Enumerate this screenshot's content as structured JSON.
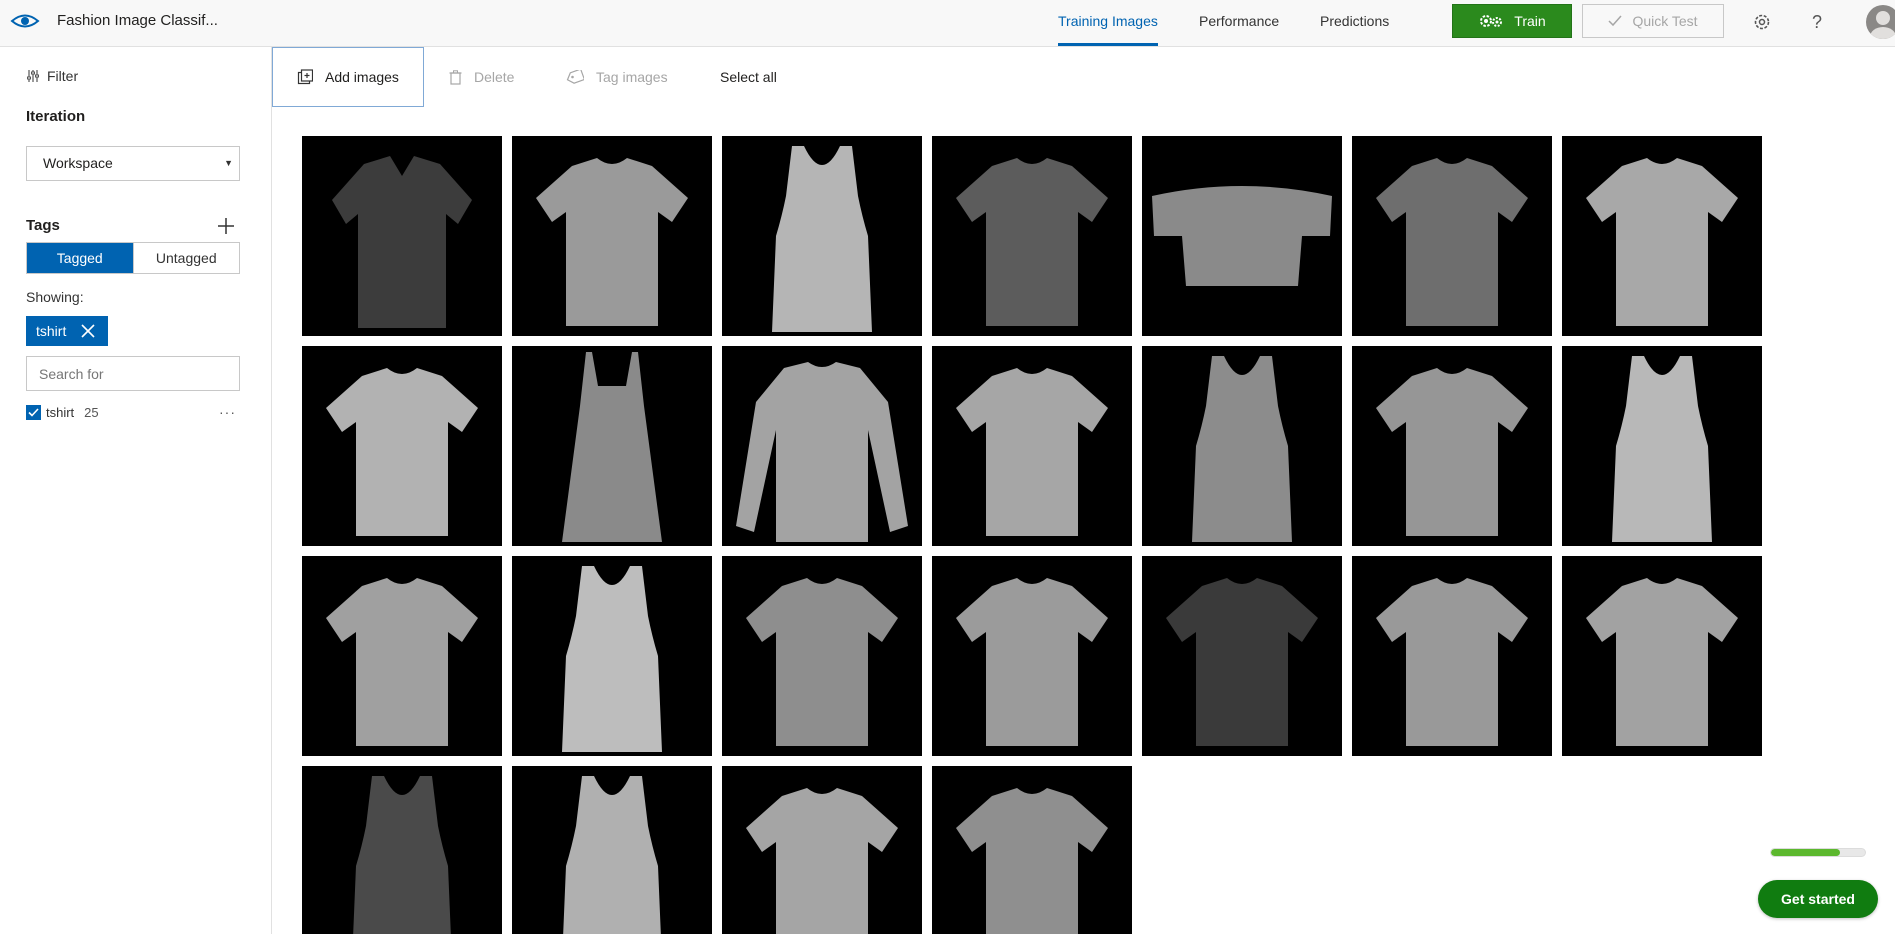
{
  "app": {
    "title": "Fashion Image Classif..."
  },
  "nav": {
    "tabs": [
      {
        "label": "Training Images",
        "active": true
      },
      {
        "label": "Performance",
        "active": false
      },
      {
        "label": "Predictions",
        "active": false
      }
    ],
    "train_label": "Train",
    "quick_test_label": "Quick Test",
    "icons": [
      "settings-gear-icon",
      "help-question-icon",
      "user-avatar"
    ]
  },
  "sidebar": {
    "filter_label": "Filter",
    "iteration_heading": "Iteration",
    "iteration_selected": "Workspace",
    "tags_heading": "Tags",
    "toggle": {
      "tagged": "Tagged",
      "untagged": "Untagged",
      "selected": "Tagged"
    },
    "showing_label": "Showing:",
    "active_filter_chip": "tshirt",
    "search_placeholder": "Search for",
    "tags": [
      {
        "name": "tshirt",
        "count": "25",
        "checked": true
      }
    ]
  },
  "toolbar": {
    "add_images": "Add images",
    "delete": "Delete",
    "tag_images": "Tag images",
    "select_all": "Select all"
  },
  "images": [
    {
      "kind": "polo",
      "shade": "#3c3c3c"
    },
    {
      "kind": "tee",
      "shade": "#9a9a9a"
    },
    {
      "kind": "tank",
      "shade": "#b5b5b5"
    },
    {
      "kind": "tee",
      "shade": "#5c5c5c"
    },
    {
      "kind": "crop",
      "shade": "#8a8a8a"
    },
    {
      "kind": "tee",
      "shade": "#6e6e6e"
    },
    {
      "kind": "tee",
      "shade": "#a8a8a8"
    },
    {
      "kind": "tee",
      "shade": "#b2b2b2"
    },
    {
      "kind": "cami",
      "shade": "#8a8a8a"
    },
    {
      "kind": "longsleeve",
      "shade": "#a3a3a3"
    },
    {
      "kind": "tee",
      "shade": "#a6a6a6"
    },
    {
      "kind": "tank",
      "shade": "#8c8c8c"
    },
    {
      "kind": "tee",
      "shade": "#969696"
    },
    {
      "kind": "tank",
      "shade": "#b8b8b8"
    },
    {
      "kind": "tee",
      "shade": "#a0a0a0"
    },
    {
      "kind": "tank",
      "shade": "#bdbdbd"
    },
    {
      "kind": "tee",
      "shade": "#8e8e8e"
    },
    {
      "kind": "tee",
      "shade": "#9b9b9b"
    },
    {
      "kind": "tee",
      "shade": "#3a3a3a"
    },
    {
      "kind": "tee",
      "shade": "#999999"
    },
    {
      "kind": "tee",
      "shade": "#a2a2a2"
    },
    {
      "kind": "tank",
      "shade": "#4a4a4a"
    },
    {
      "kind": "tank",
      "shade": "#b0b0b0"
    },
    {
      "kind": "tee",
      "shade": "#a5a5a5"
    },
    {
      "kind": "tee",
      "shade": "#8f8f8f"
    }
  ],
  "training_progress": 0.73,
  "get_started_label": "Get started",
  "colors": {
    "accent_blue": "#0063b1",
    "train_green": "#2b8a1d",
    "get_started_green": "#107c10",
    "progress_green": "#5cb82e"
  }
}
